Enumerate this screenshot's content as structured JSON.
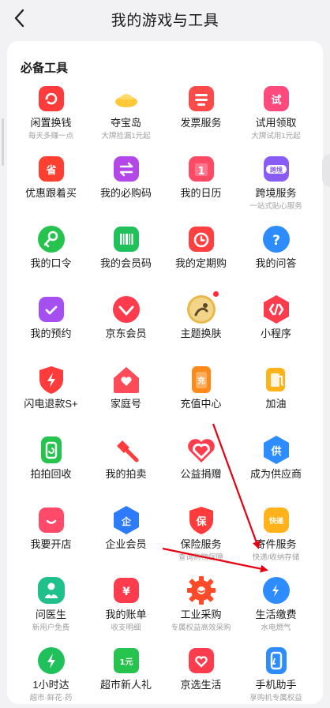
{
  "header": {
    "title": "我的游戏与工具"
  },
  "section": {
    "title": "必备工具"
  },
  "tools": [
    {
      "label": "闲置换钱",
      "sub": "每天多赚一点",
      "icon": "refresh-bag-icon",
      "color": "#ff3b3b"
    },
    {
      "label": "夺宝岛",
      "sub": "大牌捡漏1元起",
      "icon": "gold-ingot-icon",
      "color": "#ffb21a"
    },
    {
      "label": "发票服务",
      "sub": "",
      "icon": "receipt-icon",
      "color": "#ff4a4a"
    },
    {
      "label": "试用领取",
      "sub": "大牌试用1元起",
      "icon": "trial-bag-icon",
      "color": "#ff4a7d"
    },
    {
      "label": "优惠跟着买",
      "sub": "",
      "icon": "save-tag-icon",
      "color": "#ff4030"
    },
    {
      "label": "我的必购码",
      "sub": "",
      "icon": "exchange-icon",
      "color": "#b447e8"
    },
    {
      "label": "我的日历",
      "sub": "",
      "icon": "calendar-icon",
      "color": "#ff4a66"
    },
    {
      "label": "跨境服务",
      "sub": "一站式贴心服务",
      "icon": "cross-border-icon",
      "color": "#8a5cf6"
    },
    {
      "label": "我的口令",
      "sub": "",
      "icon": "key-icon",
      "color": "#26c44f"
    },
    {
      "label": "我的会员码",
      "sub": "",
      "icon": "barcode-icon",
      "color": "#20c05a"
    },
    {
      "label": "我的定期购",
      "sub": "",
      "icon": "alarm-clock-icon",
      "color": "#ff4040"
    },
    {
      "label": "我的问答",
      "sub": "",
      "icon": "question-icon",
      "color": "#2d8cff"
    },
    {
      "label": "我的预约",
      "sub": "",
      "icon": "check-calendar-icon",
      "color": "#a54ff0"
    },
    {
      "label": "京东会员",
      "sub": "",
      "icon": "member-diamond-icon",
      "color": "#ff3b4e"
    },
    {
      "label": "主题换肤",
      "sub": "",
      "icon": "theme-avatar-icon",
      "color": "#e8b84a"
    },
    {
      "label": "小程序",
      "sub": "",
      "icon": "mini-program-icon",
      "color": "#ff3b4e"
    },
    {
      "label": "闪电退款S+",
      "sub": "",
      "icon": "lightning-shield-icon",
      "color": "#ff3b3b"
    },
    {
      "label": "家庭号",
      "sub": "",
      "icon": "home-heart-icon",
      "color": "#ff4a5a"
    },
    {
      "label": "充值中心",
      "sub": "",
      "icon": "phone-charge-icon",
      "color": "#ff8a1a"
    },
    {
      "label": "加油",
      "sub": "",
      "icon": "fuel-pump-icon",
      "color": "#ffb21a"
    },
    {
      "label": "拍拍回收",
      "sub": "",
      "icon": "recycle-phone-icon",
      "color": "#26c44f"
    },
    {
      "label": "我的拍卖",
      "sub": "",
      "icon": "auction-hammer-icon",
      "color": "#ff3b3b"
    },
    {
      "label": "公益捐赠",
      "sub": "",
      "icon": "charity-heart-icon",
      "color": "#ff3b4e"
    },
    {
      "label": "成为供应商",
      "sub": "",
      "icon": "supplier-icon",
      "color": "#2d8cff"
    },
    {
      "label": "我要开店",
      "sub": "",
      "icon": "shop-bag-icon",
      "color": "#ff4a6a"
    },
    {
      "label": "企业会员",
      "sub": "",
      "icon": "enterprise-icon",
      "color": "#2d7cff"
    },
    {
      "label": "保险服务",
      "sub": "查询购物保障",
      "icon": "insurance-shield-icon",
      "color": "#ff3b3b"
    },
    {
      "label": "寄件服务",
      "sub": "快递/收纳存储",
      "icon": "express-box-icon",
      "color": "#ffb21a"
    },
    {
      "label": "问医生",
      "sub": "新用户免费",
      "icon": "doctor-icon",
      "color": "#20c08a"
    },
    {
      "label": "我的账单",
      "sub": "收支明细",
      "icon": "bill-yen-icon",
      "color": "#ff3b4e"
    },
    {
      "label": "工业采购",
      "sub": "专属权益高效采购",
      "icon": "industrial-gear-icon",
      "color": "#ff4a2a"
    },
    {
      "label": "生活缴费",
      "sub": "水电燃气",
      "icon": "water-drop-icon",
      "color": "#2d8cff"
    },
    {
      "label": "1小时达",
      "sub": "超市·鲜花·药",
      "icon": "fast-delivery-icon",
      "color": "#20c05a"
    },
    {
      "label": "超市新人礼",
      "sub": "",
      "icon": "one-yuan-icon",
      "color": "#26c44f"
    },
    {
      "label": "京选生活",
      "sub": "",
      "icon": "heart-shield-icon",
      "color": "#ff3b4e"
    },
    {
      "label": "手机助手",
      "sub": "享购机专属权益",
      "icon": "phone-assistant-icon",
      "color": "#2d8cff"
    }
  ],
  "annotation_color": "#e60012"
}
